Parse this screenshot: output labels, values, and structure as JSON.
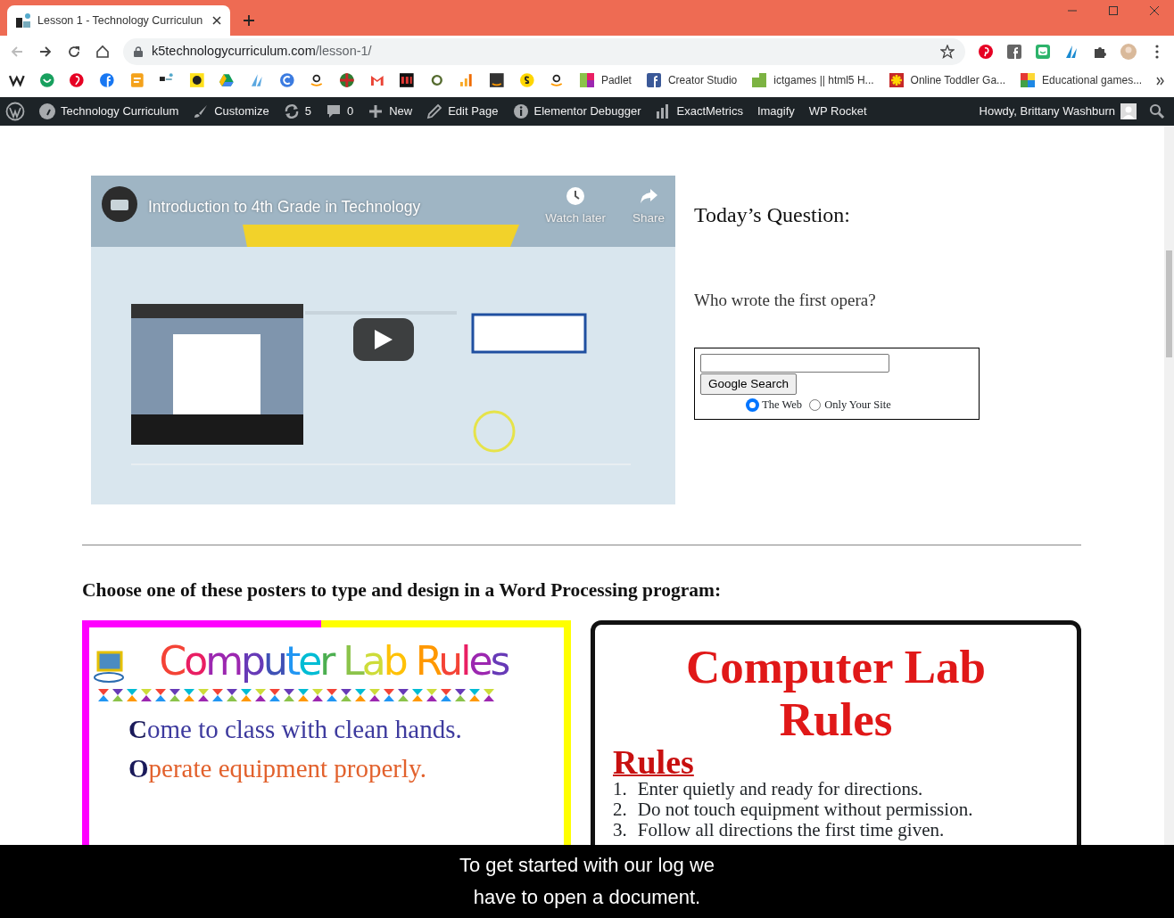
{
  "browser": {
    "tabs": [
      {
        "title": "Lesson 1 - Technology Curriculun",
        "selected": true
      }
    ],
    "address": {
      "host": "k5technologycurriculum.com",
      "path": "/lesson-1/"
    },
    "bookmarks": [
      {
        "label": "Padlet"
      },
      {
        "label": "Creator Studio"
      },
      {
        "label": "ictgames || html5 H..."
      },
      {
        "label": "Online Toddler Ga..."
      },
      {
        "label": "Educational games..."
      }
    ]
  },
  "admin_bar": {
    "items": [
      {
        "label": "Technology Curriculum"
      },
      {
        "label": "Customize"
      },
      {
        "label": "5"
      },
      {
        "label": "0"
      },
      {
        "label": "New"
      },
      {
        "label": "Edit Page"
      },
      {
        "label": "Elementor Debugger"
      },
      {
        "label": "ExactMetrics"
      },
      {
        "label": "Imagify"
      },
      {
        "label": "WP Rocket"
      }
    ],
    "greeting": "Howdy, Brittany Washburn"
  },
  "video": {
    "kind": "picture",
    "title": "Introduction to 4th Grade in Technology",
    "actions": [
      "Watch later",
      "Share"
    ]
  },
  "question_panel": {
    "heading": "Today’s Question:",
    "question": "Who wrote the first opera?",
    "search": {
      "button": "Google Search",
      "options": [
        {
          "label": "The Web",
          "selected": true
        },
        {
          "label": "Only Your Site",
          "selected": false
        }
      ]
    }
  },
  "posters_heading": "Choose one of these posters to type and design in a Word Processing program:",
  "posters": [
    {
      "title": "Computer Lab Rules",
      "lines": [
        {
          "text": "**C**ome to class with clean hands.",
          "color": "#3d3a9e"
        },
        {
          "text": "**O**perate equipment properly.",
          "color": "#e2612c"
        }
      ]
    },
    {
      "title": "Computer Lab Rules",
      "subheading": "Rules",
      "items": [
        {
          "number": "1.",
          "text": "Enter quietly and ready for directions."
        },
        {
          "number": "2.",
          "text": "Do not touch equipment without permission."
        },
        {
          "number": "3.",
          "text": "Follow all directions the first time given."
        }
      ]
    }
  ],
  "captions": [
    "To get started with our log we",
    "have to open a document."
  ]
}
